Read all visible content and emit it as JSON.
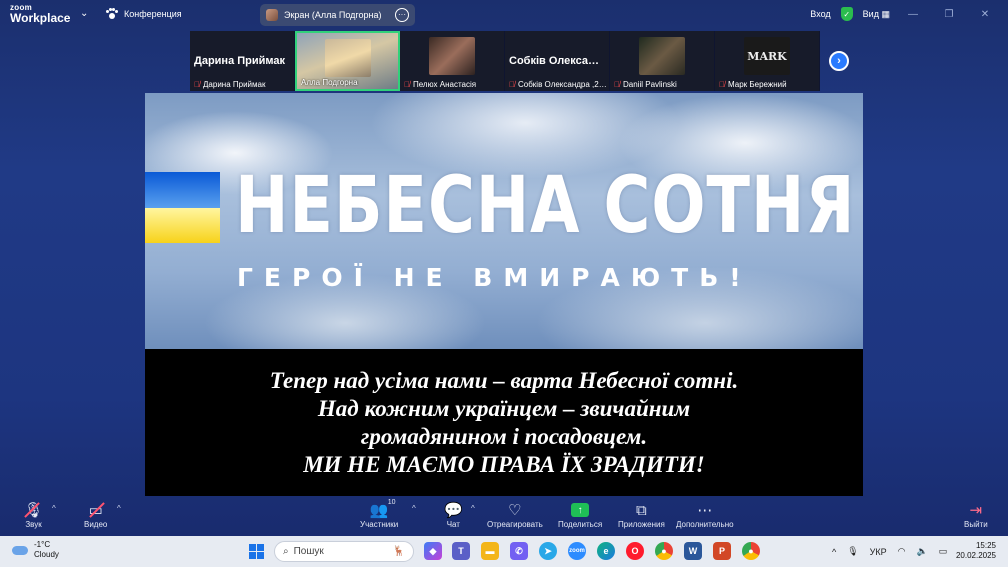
{
  "app": {
    "logo_line1": "zoom",
    "logo_line2": "Workplace",
    "conference_label": "Конференция",
    "screen_share_label": "Экран (Алла Подгорна)",
    "signin_label": "Вход",
    "view_label": "Вид"
  },
  "participants": [
    {
      "big_name": "Дарина Приймак",
      "caption": "Дарина Приймак",
      "video": false,
      "active": false
    },
    {
      "big_name": "",
      "caption": "Алла Подгорна",
      "video": true,
      "active": true
    },
    {
      "big_name": "",
      "caption": "Пелюх Анастасія",
      "video": true,
      "active": false
    },
    {
      "big_name": "Собків Олександ…",
      "caption": "Собків Олександра ,2…",
      "video": false,
      "active": false
    },
    {
      "big_name": "",
      "caption": "Daniil Pavlinski",
      "video": true,
      "active": false
    },
    {
      "big_name": "",
      "caption": "Марк Бережний",
      "video": true,
      "active": false,
      "photo_text": "MARK"
    }
  ],
  "shared": {
    "banner_title": "НЕБЕСНА СОТНЯ",
    "banner_subtitle": "ГЕРОЇ НЕ ВМИРАЮТЬ!",
    "quote_lines": [
      "Тепер над усіма нами – варта Небесної сотні.",
      "Над кожним українцем – звичайним",
      "громадянином і посадовцем.",
      "МИ НЕ МАЄМО ПРАВА ЇХ ЗРАДИТИ!"
    ]
  },
  "controls": {
    "audio": "Звук",
    "video": "Видео",
    "participants": "Участники",
    "participants_count": "10",
    "chat": "Чат",
    "react": "Отреагировать",
    "share": "Поделиться",
    "apps": "Приложения",
    "more": "Дополнительно",
    "leave": "Выйти"
  },
  "taskbar": {
    "temperature": "-1°C",
    "weather": "Cloudy",
    "search_placeholder": "Пошук",
    "language": "УКР",
    "time": "15:25",
    "date": "20.02.2025"
  }
}
